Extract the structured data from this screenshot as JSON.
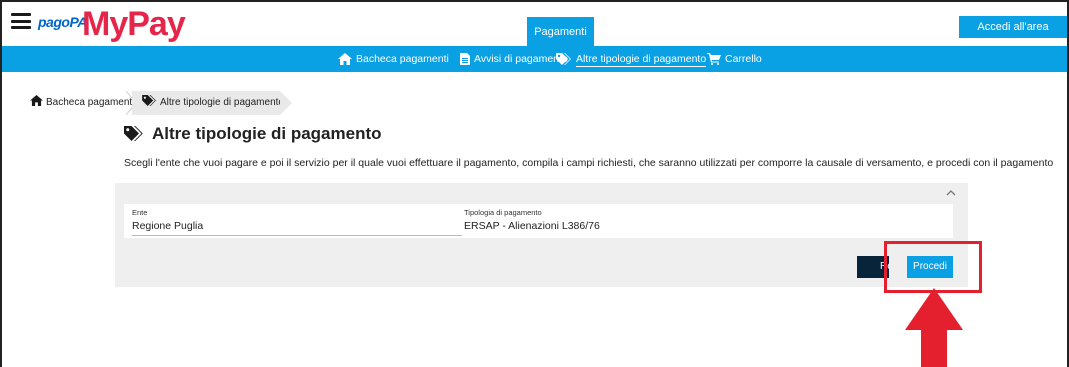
{
  "header": {
    "logo_pagopa": "pagoPA",
    "logo_mypay": "MyPay",
    "tab_label": "Pagamenti",
    "login_label": "Accedi all'area personale"
  },
  "nav": {
    "items": [
      {
        "label": "Bacheca pagamenti",
        "icon": "home-icon"
      },
      {
        "label": "Avvisi di pagamento",
        "icon": "document-icon"
      },
      {
        "label": "Altre tipologie di pagamento",
        "icon": "tags-icon",
        "active": true
      },
      {
        "label": "Carrello",
        "icon": "cart-icon"
      }
    ]
  },
  "breadcrumb": {
    "home": "Bacheca pagamenti",
    "current": "Altre tipologie di pagamento"
  },
  "page": {
    "title": "Altre tipologie di pagamento",
    "description": "Scegli l'ente che vuoi pagare e poi il servizio per il quale vuoi effettuare il pagamento, compila i campi richiesti, che saranno utilizzati per comporre la causale di versamento, e procedi con il pagamento"
  },
  "form": {
    "ente_label": "Ente",
    "ente_value": "Regione Puglia",
    "tipologia_label": "Tipologia di pagamento",
    "tipologia_value": "ERSAP - Alienazioni L386/76",
    "reset_label": "Reset",
    "procedi_label": "Procedi"
  },
  "colors": {
    "primary": "#0aa0e4",
    "dark_button": "#07243a",
    "logo_red": "#e6254a",
    "annotation_red": "#e5202e"
  }
}
